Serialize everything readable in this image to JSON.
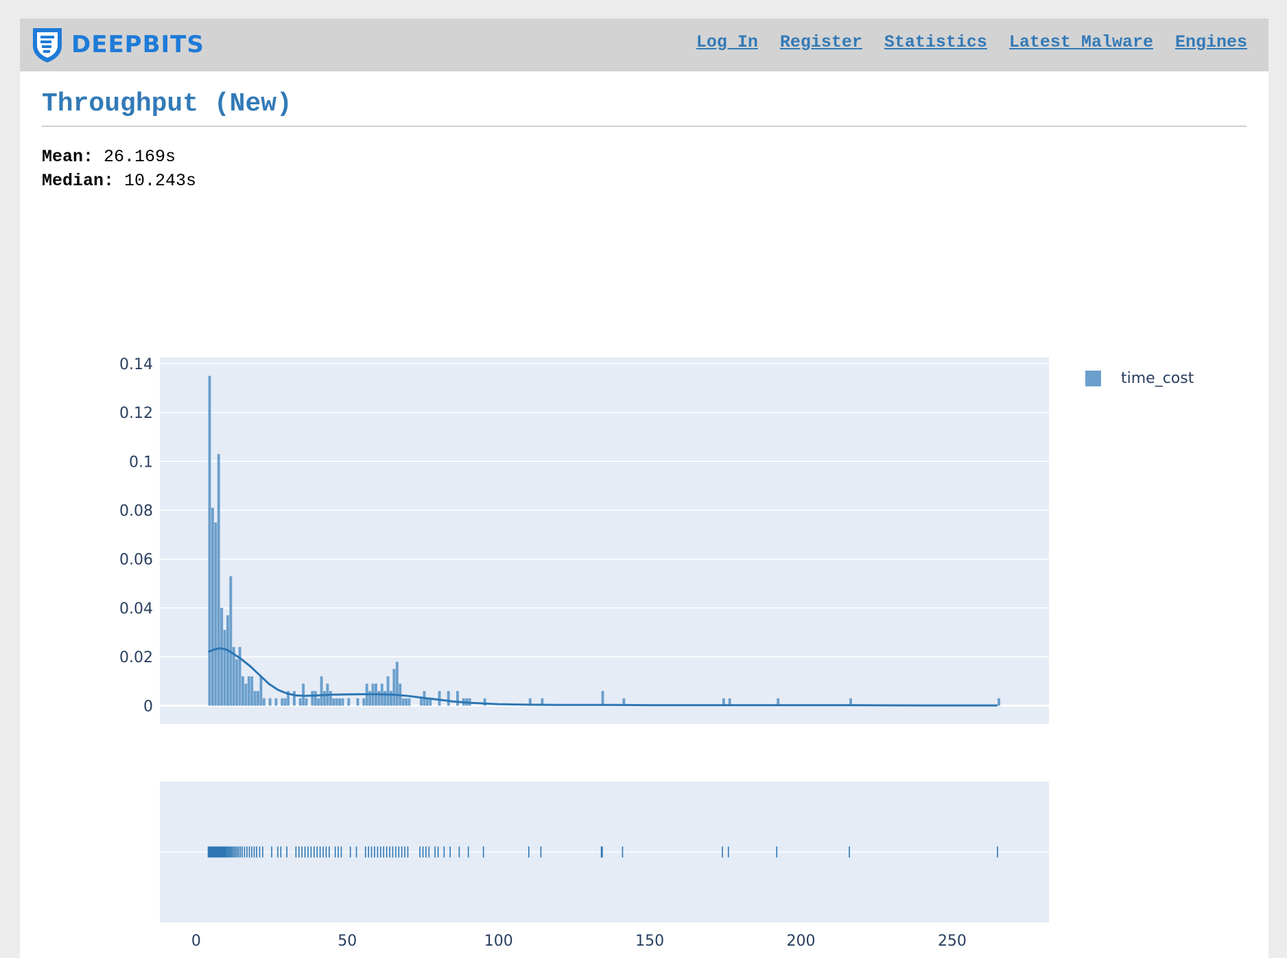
{
  "brand": {
    "name": "DEEPBITS"
  },
  "nav": {
    "links": [
      {
        "label": "Log In"
      },
      {
        "label": "Register"
      },
      {
        "label": "Statistics"
      },
      {
        "label": "Latest Malware"
      },
      {
        "label": "Engines"
      }
    ]
  },
  "page": {
    "title": "Throughput (New)"
  },
  "stats": {
    "mean_label": "Mean:",
    "mean_value": "26.169s",
    "median_label": "Median:",
    "median_value": "10.243s"
  },
  "colors": {
    "accent": "#337ab7",
    "brand": "#1e7bd8",
    "bar": "#6b9fcc",
    "line": "#2c76b3",
    "plot_bg": "#e5ecf6"
  },
  "chart_data": {
    "type": "bar",
    "legend": {
      "entries": [
        "time_cost"
      ],
      "position": "top-right"
    },
    "grid": true,
    "histogram": {
      "bin_width": 1,
      "x": [
        4,
        5,
        6,
        7,
        8,
        9,
        10,
        11,
        12,
        13,
        14,
        15,
        16,
        17,
        18,
        19,
        20,
        21,
        22,
        24,
        26,
        28,
        29,
        30,
        32,
        34,
        35,
        36,
        38,
        39,
        40,
        41,
        42,
        43,
        44,
        45,
        46,
        47,
        48,
        50,
        53,
        55,
        56,
        57,
        58,
        59,
        60,
        61,
        62,
        63,
        64,
        65,
        66,
        67,
        68,
        69,
        70,
        74,
        75,
        76,
        77,
        80,
        83,
        86,
        88,
        89,
        90,
        95,
        110,
        114,
        134,
        141,
        174,
        176,
        192,
        216,
        265
      ],
      "y": [
        0.135,
        0.081,
        0.075,
        0.103,
        0.04,
        0.031,
        0.037,
        0.053,
        0.024,
        0.019,
        0.024,
        0.012,
        0.009,
        0.012,
        0.012,
        0.006,
        0.006,
        0.012,
        0.003,
        0.003,
        0.003,
        0.003,
        0.003,
        0.006,
        0.006,
        0.003,
        0.009,
        0.003,
        0.006,
        0.006,
        0.003,
        0.012,
        0.006,
        0.009,
        0.006,
        0.003,
        0.003,
        0.003,
        0.003,
        0.003,
        0.003,
        0.003,
        0.009,
        0.006,
        0.009,
        0.009,
        0.006,
        0.009,
        0.006,
        0.012,
        0.006,
        0.015,
        0.018,
        0.009,
        0.003,
        0.003,
        0.003,
        0.003,
        0.006,
        0.003,
        0.003,
        0.006,
        0.006,
        0.006,
        0.003,
        0.003,
        0.003,
        0.003,
        0.003,
        0.003,
        0.006,
        0.003,
        0.003,
        0.003,
        0.003,
        0.003,
        0.003
      ]
    },
    "density_curve": {
      "x": [
        4,
        6,
        8,
        10,
        12,
        15,
        18,
        21,
        24,
        27,
        30,
        33,
        36,
        40,
        45,
        50,
        55,
        60,
        65,
        70,
        75,
        80,
        85,
        90,
        95,
        100,
        110,
        120,
        134,
        150,
        170,
        192,
        216,
        240,
        265
      ],
      "y": [
        0.022,
        0.023,
        0.0235,
        0.023,
        0.0215,
        0.019,
        0.016,
        0.0125,
        0.009,
        0.0065,
        0.005,
        0.0042,
        0.004,
        0.0042,
        0.0045,
        0.0046,
        0.0047,
        0.0047,
        0.0045,
        0.004,
        0.0032,
        0.0025,
        0.0017,
        0.0012,
        0.0009,
        0.0006,
        0.0004,
        0.0003,
        0.0003,
        0.0002,
        0.0002,
        0.0002,
        0.0002,
        0.0001,
        0.0001
      ]
    },
    "rug": {
      "x": [
        4,
        4.3,
        4.6,
        4.9,
        5.2,
        5.5,
        5.8,
        6.1,
        6.4,
        6.7,
        7,
        7.3,
        7.6,
        7.9,
        8.2,
        8.5,
        8.8,
        9.1,
        9.4,
        9.7,
        10,
        10.4,
        10.8,
        11.2,
        11.6,
        12,
        12.5,
        13,
        13.5,
        14,
        14.6,
        15.2,
        16,
        16.8,
        17.6,
        18.4,
        19.2,
        20,
        21,
        22,
        25,
        27,
        28,
        30,
        33,
        34,
        35,
        36,
        37,
        38,
        39,
        40,
        41,
        42,
        43,
        44,
        46,
        47,
        48,
        51,
        53,
        56,
        57,
        58,
        59,
        60,
        61,
        62,
        63,
        64,
        65,
        66,
        67,
        68,
        69,
        70,
        74,
        75,
        76,
        77,
        79,
        80,
        82,
        84,
        87,
        90,
        95,
        110,
        114,
        134,
        134.3,
        141,
        174,
        176,
        192,
        216,
        265
      ]
    },
    "xaxis": {
      "range": [
        -12,
        282
      ],
      "ticks": [
        0,
        50,
        100,
        150,
        200,
        250
      ],
      "tick_labels": [
        "0",
        "50",
        "100",
        "150",
        "200",
        "250"
      ]
    },
    "yaxis": {
      "range": [
        -0.0075,
        0.1425
      ],
      "ticks": [
        0,
        0.02,
        0.04,
        0.06,
        0.08,
        0.1,
        0.12,
        0.14
      ],
      "tick_labels": [
        "0",
        "0.02",
        "0.04",
        "0.06",
        "0.08",
        "0.1",
        "0.12",
        "0.14"
      ]
    }
  }
}
